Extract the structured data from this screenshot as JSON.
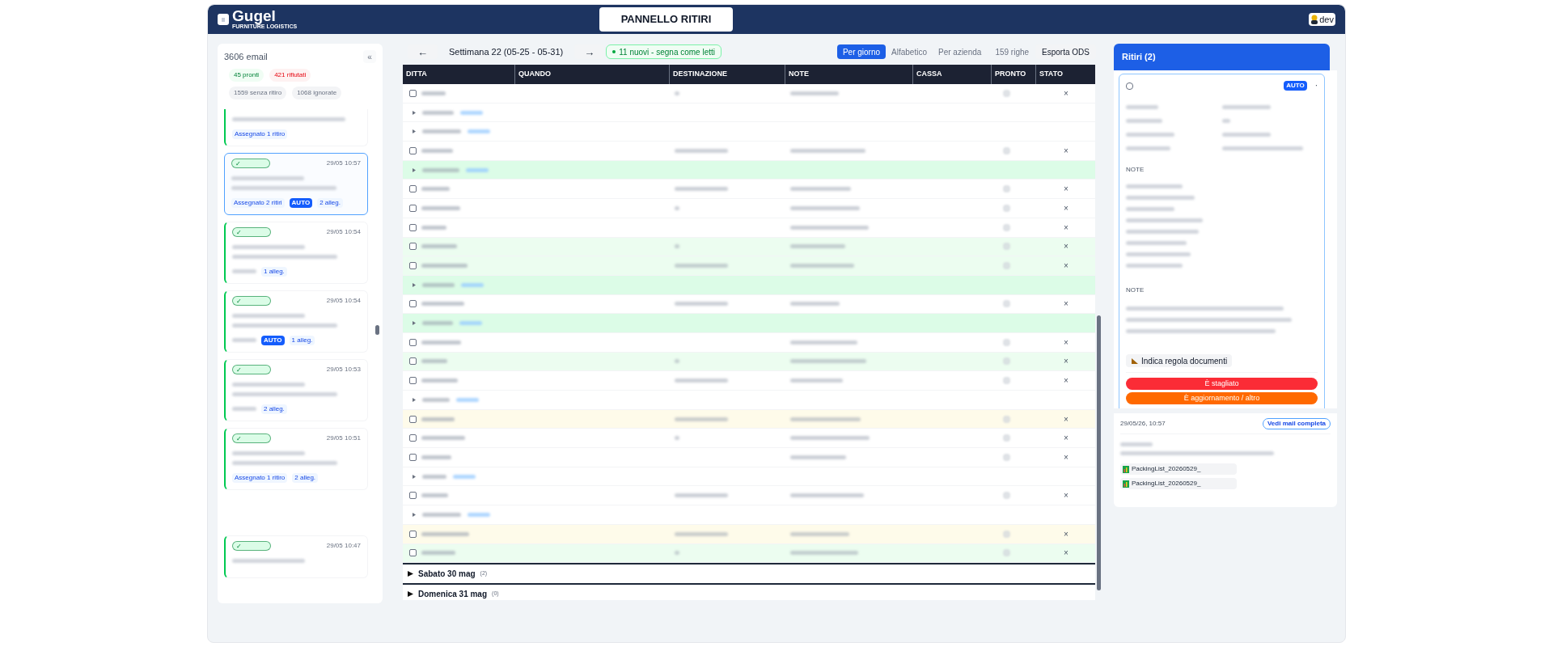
{
  "header": {
    "logo": "Gugel",
    "tagline": "FURNITURE LOGISTICS",
    "title_button": "PANNELLO RITIRI",
    "user_badge": "dev"
  },
  "email_panel": {
    "count": "3606 email",
    "collapse": "«",
    "filters": [
      {
        "label": "45 pronti",
        "kind": "ready"
      },
      {
        "label": "421 rifiutati",
        "kind": "rejected"
      },
      {
        "label": "1559 senza ritiro",
        "kind": "neutral"
      },
      {
        "label": "1068 ignorate",
        "kind": "neutral"
      }
    ],
    "emails": [
      {
        "selected": false,
        "tags": [
          {
            "kind": "assign",
            "label": "Assegnato 1 ritiro"
          }
        ]
      },
      {
        "selected": true,
        "status": "✓",
        "time": "29/05 10:57",
        "tags": [
          {
            "kind": "assign",
            "label": "Assegnato 2 ritiri"
          },
          {
            "kind": "auto",
            "label": "AUTO"
          },
          {
            "kind": "attach",
            "label": "2 alleg."
          }
        ]
      },
      {
        "selected": false,
        "status": "✓",
        "time": "29/05 10:54",
        "tags": [
          {
            "kind": "blurred"
          },
          {
            "kind": "attach",
            "label": "1 alleg."
          }
        ]
      },
      {
        "selected": false,
        "status": "✓",
        "time": "29/05 10:54",
        "tags": [
          {
            "kind": "blurred"
          },
          {
            "kind": "auto",
            "label": "AUTO"
          },
          {
            "kind": "attach",
            "label": "1 alleg."
          }
        ]
      },
      {
        "selected": false,
        "status": "✓",
        "time": "29/05 10:53",
        "tags": [
          {
            "kind": "blurred"
          },
          {
            "kind": "attach",
            "label": "2 alleg."
          }
        ]
      },
      {
        "selected": false,
        "status": "✓",
        "time": "29/05 10:51",
        "tags": [
          {
            "kind": "assign",
            "label": "Assegnato 1 ritiro"
          },
          {
            "kind": "attach",
            "label": "2 alleg."
          }
        ]
      },
      {
        "selected": false,
        "status": "✓",
        "time": "29/05 10:47"
      }
    ]
  },
  "toolbar": {
    "prev": "←",
    "week": "Settimana 22 (05-25 - 05-31)",
    "next": "→",
    "new_badge": "11 nuovi - segna come letti",
    "sort_tabs": [
      {
        "label": "Per giorno",
        "selected": true
      },
      {
        "label": "Alfabetico",
        "selected": false
      },
      {
        "label": "Per azienda",
        "selected": false
      }
    ],
    "row_count": "159 righe",
    "export": "Esporta ODS"
  },
  "table": {
    "columns": [
      "DITTA",
      "QUANDO",
      "DESTINAZIONE",
      "NOTE",
      "CASSA",
      "PRONTO",
      "STATO"
    ],
    "rows": [
      {
        "kind": "item",
        "color": "#ffffff",
        "checked": false,
        "stato": "×"
      },
      {
        "kind": "group",
        "color": "#ffffff"
      },
      {
        "kind": "group",
        "color": "#ffffff"
      },
      {
        "kind": "item",
        "color": "#ffffff",
        "checked": false,
        "stato": "×"
      },
      {
        "kind": "group",
        "color": "#dcfce7"
      },
      {
        "kind": "item",
        "color": "#ffffff",
        "checked": false,
        "stato": "×"
      },
      {
        "kind": "item",
        "color": "#ffffff",
        "checked": false,
        "stato": "×"
      },
      {
        "kind": "item",
        "color": "#ffffff",
        "checked": false,
        "stato": "×"
      },
      {
        "kind": "item",
        "color": "#ecfdf0",
        "checked": false,
        "stato": "×"
      },
      {
        "kind": "item",
        "color": "#ecfdf0",
        "checked": false,
        "stato": "×"
      },
      {
        "kind": "group",
        "color": "#dcfce7"
      },
      {
        "kind": "item",
        "color": "#ffffff",
        "checked": false,
        "stato": "×"
      },
      {
        "kind": "group",
        "color": "#dcfce7"
      },
      {
        "kind": "item",
        "color": "#ffffff",
        "checked": false,
        "stato": "×"
      },
      {
        "kind": "item",
        "color": "#ecfdf0",
        "checked": false,
        "stato": "×"
      },
      {
        "kind": "item",
        "color": "#ffffff",
        "checked": false,
        "stato": "×"
      },
      {
        "kind": "group",
        "color": "#ffffff"
      },
      {
        "kind": "item",
        "color": "#fefbea",
        "checked": false,
        "stato": "×"
      },
      {
        "kind": "item",
        "color": "#ffffff",
        "checked": false,
        "stato": "×"
      },
      {
        "kind": "item",
        "color": "#ffffff",
        "checked": false,
        "stato": "×"
      },
      {
        "kind": "group",
        "color": "#ffffff"
      },
      {
        "kind": "item",
        "color": "#ffffff",
        "checked": false,
        "stato": "×"
      },
      {
        "kind": "group",
        "color": "#ffffff"
      },
      {
        "kind": "item",
        "color": "#fefbea",
        "checked": false,
        "stato": "×"
      },
      {
        "kind": "item",
        "color": "#ecfdf0",
        "checked": false,
        "stato": "×"
      }
    ],
    "days": [
      {
        "label": "Sabato 30 mag",
        "count": "(2)",
        "expanded": false
      },
      {
        "label": "Domenica 31 mag",
        "count": "(0)",
        "expanded": false
      }
    ]
  },
  "detail": {
    "title": "Ritiri (2)",
    "card": {
      "checked": false,
      "badge": "AUTO",
      "menu": "·",
      "sections": [
        "NOTE",
        "NOTE"
      ],
      "rule_button": "Indica regola documenti",
      "actions": [
        {
          "label": "È stagliato",
          "kind": "danger"
        },
        {
          "label": "È aggiornamento / altro",
          "kind": "warning"
        }
      ]
    },
    "mail": {
      "date": "29/05/26, 10:57",
      "open_button": "Vedi mail completa",
      "attachments": [
        "PackingList_20260529_",
        "PackingList_20260529_"
      ]
    }
  }
}
